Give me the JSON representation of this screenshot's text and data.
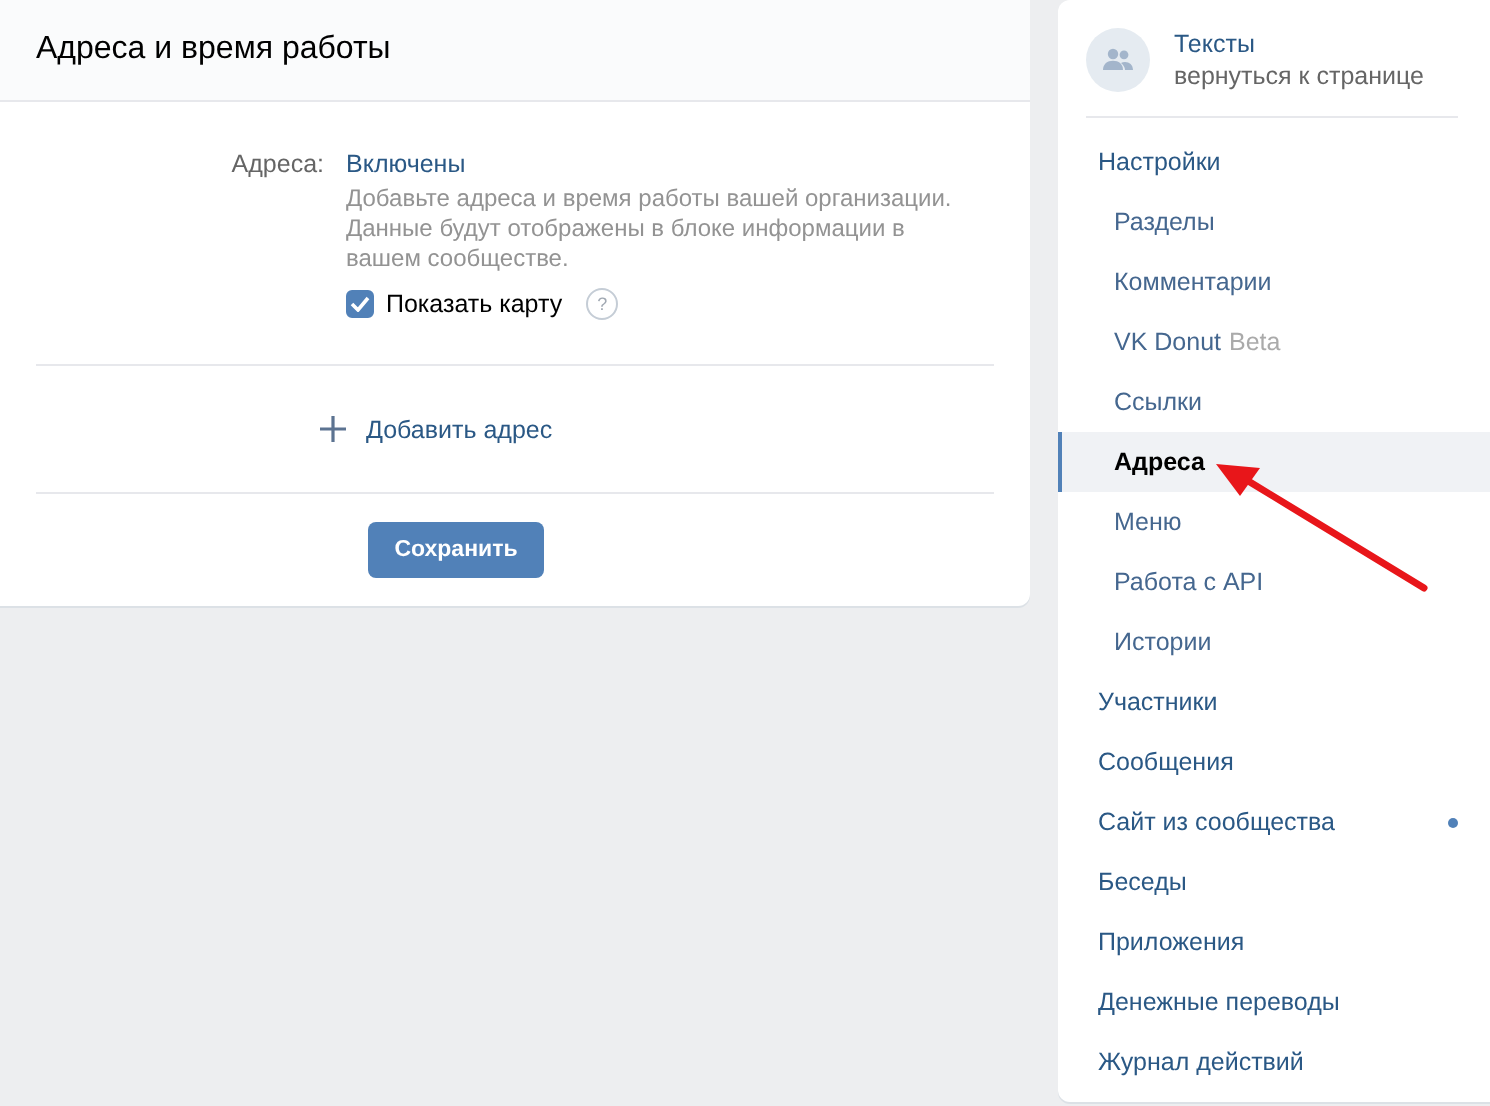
{
  "panel": {
    "title": "Адреса и время работы",
    "field_label": "Адреса:",
    "field_value": "Включены",
    "description": "Добавьте адреса и время работы вашей организации. Данные будут отображены в блоке информации в вашем сообществе.",
    "show_map": {
      "label": "Показать карту",
      "checked": true,
      "help": "?"
    },
    "add_address": "Добавить адрес",
    "save_button": "Сохранить"
  },
  "sidebar": {
    "community": {
      "name": "Тексты",
      "back_link": "вернуться к странице"
    },
    "items": [
      {
        "label": "Настройки",
        "kind": "section",
        "selected": false
      },
      {
        "label": "Разделы",
        "kind": "sub",
        "selected": false
      },
      {
        "label": "Комментарии",
        "kind": "sub",
        "selected": false
      },
      {
        "label": "VK Donut",
        "badge": "Beta",
        "kind": "sub",
        "selected": false
      },
      {
        "label": "Ссылки",
        "kind": "sub",
        "selected": false
      },
      {
        "label": "Адреса",
        "kind": "sub",
        "selected": true
      },
      {
        "label": "Меню",
        "kind": "sub",
        "selected": false
      },
      {
        "label": "Работа с API",
        "kind": "sub",
        "selected": false
      },
      {
        "label": "Истории",
        "kind": "sub",
        "selected": false
      },
      {
        "label": "Участники",
        "kind": "section",
        "selected": false
      },
      {
        "label": "Сообщения",
        "kind": "section",
        "selected": false
      },
      {
        "label": "Сайт из сообщества",
        "kind": "section",
        "selected": false,
        "dot": true
      },
      {
        "label": "Беседы",
        "kind": "section",
        "selected": false
      },
      {
        "label": "Приложения",
        "kind": "section",
        "selected": false
      },
      {
        "label": "Денежные переводы",
        "kind": "section",
        "selected": false
      },
      {
        "label": "Журнал действий",
        "kind": "section",
        "selected": false
      }
    ]
  }
}
